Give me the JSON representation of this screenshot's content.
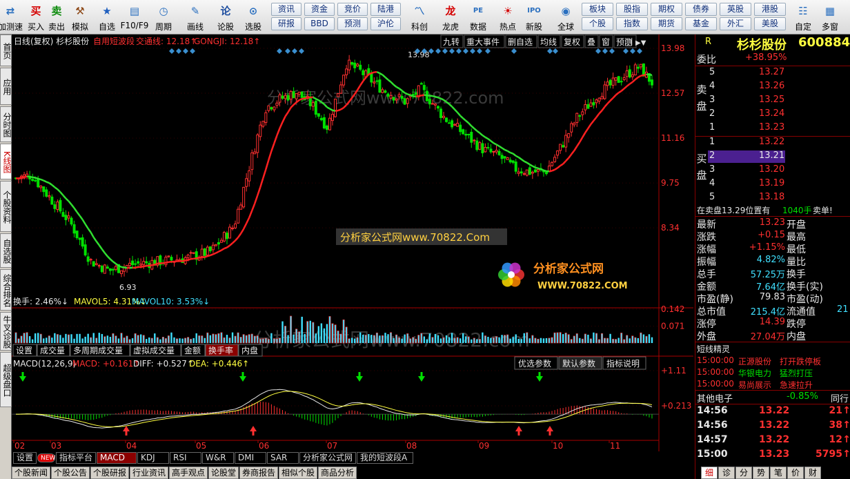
{
  "toolbar": {
    "buttons": [
      {
        "label": "加测速",
        "icon": "network-icon",
        "sym": "⇄",
        "color": "#2a6fbf"
      },
      {
        "label": "买入",
        "icon": "buy-icon",
        "sym": "买",
        "color": "#d40000"
      },
      {
        "label": "卖出",
        "icon": "sell-icon",
        "sym": "卖",
        "color": "#0a8a0a"
      },
      {
        "label": "模拟",
        "icon": "hammer-icon",
        "sym": "⚒",
        "color": "#8b4513"
      },
      {
        "label": "自选",
        "icon": "star-icon",
        "sym": "★",
        "color": "#1f5fbf"
      },
      {
        "label": "F10/F9",
        "icon": "f10-icon",
        "sym": "▤",
        "color": "#2a6fbf"
      },
      {
        "label": "周期",
        "icon": "clock-icon",
        "sym": "◷",
        "color": "#2a6fbf"
      },
      {
        "label": "画线",
        "icon": "pencil-icon",
        "sym": "✎",
        "color": "#2a6fbf"
      },
      {
        "label": "论股",
        "icon": "discuss-icon",
        "sym": "论",
        "color": "#1f4fa0"
      },
      {
        "label": "选股",
        "icon": "select-stock-icon",
        "sym": "⊙",
        "color": "#2a6fbf"
      },
      {
        "label": "科创",
        "icon": "kechuang-icon",
        "sym": "〽",
        "color": "#2a6fbf"
      },
      {
        "label": "龙虎",
        "icon": "dragon-icon",
        "sym": "龙",
        "color": "#d40000"
      },
      {
        "label": "数据",
        "icon": "pe-icon",
        "sym": "PE",
        "color": "#2a6fbf"
      },
      {
        "label": "热点",
        "icon": "fire-icon",
        "sym": "☀",
        "color": "#d40000"
      },
      {
        "label": "新股",
        "icon": "ipo-icon",
        "sym": "IPO",
        "color": "#2a6fbf"
      },
      {
        "label": "全球",
        "icon": "globe-icon",
        "sym": "◉",
        "color": "#2a6fbf"
      },
      {
        "label": "自定",
        "icon": "custom-icon",
        "sym": "☷",
        "color": "#2a6fbf"
      },
      {
        "label": "多窗",
        "icon": "multiwindow-icon",
        "sym": "▦",
        "color": "#2a6fbf"
      }
    ],
    "grid_a": [
      "资讯",
      "资金",
      "竞价",
      "陆港",
      "研报",
      "BBD",
      "预测",
      "沪伦"
    ],
    "grid_b": [
      "板块",
      "股指",
      "期权",
      "债券",
      "英股",
      "港股",
      "个股",
      "指数",
      "期货",
      "基金",
      "外汇",
      "美股"
    ]
  },
  "left_tabs": [
    "首页",
    "应用",
    "分时图",
    "K线图",
    "个股资料",
    "自选股",
    "综合排名",
    "牛叉诊股",
    "超级盘口"
  ],
  "chart": {
    "header": {
      "label": "日线(复权) 杉杉股份",
      "ind": "自用短波段",
      "jt": "交通线: 12.18↑",
      "gj": "GONGJI: 12.18↑"
    },
    "buttons": [
      "九转",
      "重大事件",
      "删自选",
      "均线",
      "复权",
      "叠",
      "窗",
      "预测"
    ],
    "price_axis": [
      "13.98",
      "12.57",
      "11.16",
      "9.75",
      "8.34"
    ],
    "high_label": "13.98",
    "low_label": "6.93",
    "watermark1": "分析家公式网www.70822.com",
    "watermark2": "分析家公式网www.70822.Com",
    "logo_text": "分析家公式网",
    "logo_url": "WWW.70822.COM",
    "vol_header": {
      "a": "换手: 2.46%↓",
      "b": "MAVOL5: 4.31%↓",
      "c": "MAVOL10: 3.53%↓"
    },
    "vol_axis": [
      "0.142",
      "0.071"
    ],
    "vol_tabs": [
      "设置",
      "成交量",
      "多周期成交量",
      "虚拟成交量",
      "金额",
      "换手率",
      "内盘"
    ],
    "macd_header": {
      "a": "MACD(12,26,9)",
      "b": "MACD: +0.161↑",
      "c": "DIFF: +0.527↑",
      "d": "DEA: +0.446↑"
    },
    "macd_buttons": [
      "优选参数",
      "默认参数",
      "指标说明"
    ],
    "macd_axis": [
      "+1.11",
      "+0.213"
    ],
    "months": [
      "02",
      "03",
      "04",
      "05",
      "06",
      "07",
      "08",
      "09",
      "10",
      "11"
    ]
  },
  "bottom_tabs": [
    "设置",
    "NEW",
    "指标平台",
    "MACD",
    "KDJ",
    "RSI",
    "W&R",
    "DMI",
    "SAR",
    "分析家公式网",
    "我的短波段A"
  ],
  "news_buttons": [
    "个股新闻",
    "个股公告",
    "个股研报",
    "行业资讯",
    "高手观点",
    "论股堂",
    "券商报告",
    "相似个股",
    "商品分析"
  ],
  "quote": {
    "code_prefix": "R",
    "name": "杉杉股份",
    "code": "600884",
    "webi_label": "委比",
    "webi": "+38.95%",
    "sell_label": "卖盘",
    "buy_label": "买盘",
    "asks": [
      {
        "n": "5",
        "p": "13.27"
      },
      {
        "n": "4",
        "p": "13.26"
      },
      {
        "n": "3",
        "p": "13.25"
      },
      {
        "n": "2",
        "p": "13.24"
      },
      {
        "n": "1",
        "p": "13.23"
      }
    ],
    "bids": [
      {
        "n": "1",
        "p": "13.22"
      },
      {
        "n": "2",
        "p": "13.21"
      },
      {
        "n": "3",
        "p": "13.20"
      },
      {
        "n": "4",
        "p": "13.19"
      },
      {
        "n": "5",
        "p": "13.18"
      }
    ],
    "notice": {
      "a": "在卖盘13.29位置有",
      "b": "1040手",
      "c": "卖单!"
    },
    "stats": [
      {
        "k": "最新",
        "v": "13.23",
        "k2": "开盘",
        "c": "red"
      },
      {
        "k": "涨跌",
        "v": "+0.15",
        "k2": "最高",
        "c": "red"
      },
      {
        "k": "涨幅",
        "v": "+1.15%",
        "k2": "最低",
        "c": "red"
      },
      {
        "k": "振幅",
        "v": "4.82%",
        "k2": "量比",
        "c": "cyn"
      },
      {
        "k": "总手",
        "v": "57.25万",
        "k2": "换手",
        "c": "cyn"
      },
      {
        "k": "金额",
        "v": "7.64亿",
        "k2": "换手(实)",
        "c": "cyn"
      },
      {
        "k": "市盈(静)",
        "v": "79.83",
        "k2": "市盈(动)",
        "c": "wht"
      },
      {
        "k": "总市值",
        "v": "215.4亿",
        "k2": "流通值",
        "v2": "21",
        "c": "cyn"
      },
      {
        "k": "涨停",
        "v": "14.39",
        "k2": "跌停",
        "c": "red"
      },
      {
        "k": "外盘",
        "v": "27.04万",
        "k2": "内盘",
        "c": "red"
      }
    ],
    "elves_title": "短线精灵",
    "elves": [
      {
        "t": "15:00:00",
        "s": "正源股份",
        "e": "打开跌停板",
        "c": "red"
      },
      {
        "t": "15:00:00",
        "s": "华银电力",
        "e": "猛烈打压",
        "c": "grn"
      },
      {
        "t": "15:00:00",
        "s": "易尚展示",
        "e": "急速拉升",
        "c": "red"
      }
    ],
    "sector": {
      "name": "其他电子",
      "pct": "-0.85%",
      "tail": "同行"
    },
    "ticks": [
      {
        "t": "14:56",
        "p": "13.22",
        "v": "21",
        "d": "↑"
      },
      {
        "t": "14:56",
        "p": "13.22",
        "v": "38",
        "d": "↑"
      },
      {
        "t": "14:57",
        "p": "13.22",
        "v": "12",
        "d": "↑"
      },
      {
        "t": "15:00",
        "p": "13.23",
        "v": "5795",
        "d": "↑"
      }
    ],
    "bottom_tabs": [
      "细",
      "诊",
      "分",
      "势",
      "笔",
      "价",
      "财"
    ]
  }
}
